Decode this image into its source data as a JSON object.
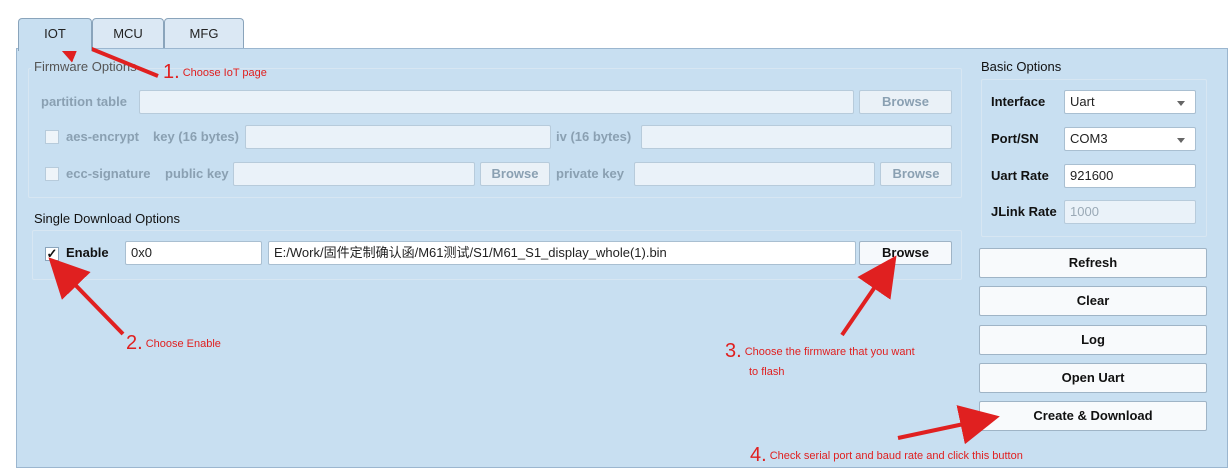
{
  "tabs": [
    "IOT",
    "MCU",
    "MFG"
  ],
  "firmware_options": {
    "legend": "Firmware Options",
    "partition_table_label": "partition table",
    "browse_label": "Browse",
    "aes_label": "aes-encrypt",
    "key_label": "key (16 bytes)",
    "iv_label": "iv (16 bytes)",
    "ecc_label": "ecc-signature",
    "public_key_label": "public key",
    "private_key_label": "private key"
  },
  "single_download": {
    "legend": "Single Download Options",
    "enable_label": "Enable",
    "enable_checked": true,
    "address": "0x0",
    "file_path": "E:/Work/固件定制确认函/M61测试/S1/M61_S1_display_whole(1).bin",
    "browse_label": "Browse"
  },
  "basic_options": {
    "legend": "Basic Options",
    "interface_label": "Interface",
    "interface_value": "Uart",
    "port_label": "Port/SN",
    "port_value": "COM3",
    "uart_rate_label": "Uart Rate",
    "uart_rate_value": "921600",
    "jlink_rate_label": "JLink Rate",
    "jlink_rate_value": "1000"
  },
  "buttons": {
    "refresh": "Refresh",
    "clear": "Clear",
    "log": "Log",
    "open_uart": "Open Uart",
    "create_download": "Create & Download"
  },
  "annotations": [
    {
      "num": "1.",
      "text": "Choose IoT page"
    },
    {
      "num": "2.",
      "text": "Choose Enable"
    },
    {
      "num": "3.",
      "text": "Choose the firmware that you want",
      "text2": "to flash"
    },
    {
      "num": "4.",
      "text": "Check serial port and baud rate and click this button"
    }
  ],
  "colors": {
    "panel": "#c8dff1",
    "annotation": "#e02020"
  }
}
